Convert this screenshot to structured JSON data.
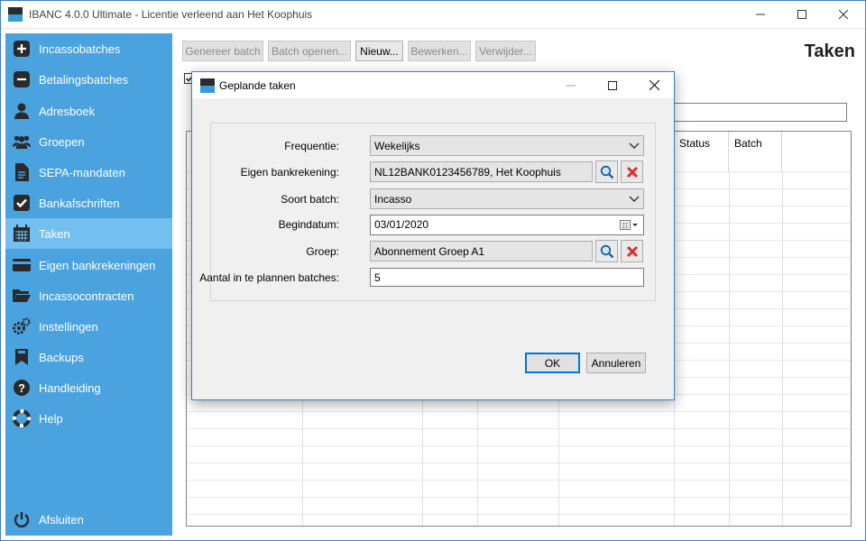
{
  "window": {
    "title": "IBANC 4.0.0 Ultimate - Licentie verleend aan Het Koophuis"
  },
  "sidebar": {
    "items": [
      {
        "label": "Incassobatches",
        "icon": "plus-circle-icon"
      },
      {
        "label": "Betalingsbatches",
        "icon": "minus-circle-icon"
      },
      {
        "label": "Adresboek",
        "icon": "person-icon"
      },
      {
        "label": "Groepen",
        "icon": "group-icon"
      },
      {
        "label": "SEPA-mandaten",
        "icon": "document-icon"
      },
      {
        "label": "Bankafschriften",
        "icon": "checkbox-icon"
      },
      {
        "label": "Taken",
        "icon": "calendar-icon"
      },
      {
        "label": "Eigen bankrekeningen",
        "icon": "card-icon"
      },
      {
        "label": "Incassocontracten",
        "icon": "folder-icon"
      },
      {
        "label": "Instellingen",
        "icon": "gear-icon"
      },
      {
        "label": "Backups",
        "icon": "bookmark-icon"
      },
      {
        "label": "Handleiding",
        "icon": "question-icon"
      },
      {
        "label": "Help",
        "icon": "lifebuoy-icon"
      }
    ],
    "active": "Taken",
    "exit_label": "Afsluiten"
  },
  "toolbar": {
    "generate": "Genereer batch",
    "open": "Batch openen...",
    "new": "Nieuw...",
    "edit": "Bewerken...",
    "delete": "Verwijder..."
  },
  "page": {
    "title": "Taken"
  },
  "grid": {
    "columns": [
      "Status",
      "Batch"
    ]
  },
  "dialog": {
    "title": "Geplande taken",
    "fields": {
      "frequency_label": "Frequentie:",
      "frequency_value": "Wekelijks",
      "account_label": "Eigen bankrekening:",
      "account_value": "NL12BANK0123456789, Het Koophuis",
      "batch_type_label": "Soort batch:",
      "batch_type_value": "Incasso",
      "start_date_label": "Begindatum:",
      "start_date_value": "03/01/2020",
      "group_label": "Groep:",
      "group_value": "Abonnement Groep A1",
      "count_label": "Aantal in te plannen batches:",
      "count_value": "5"
    },
    "ok": "OK",
    "cancel": "Annuleren"
  },
  "colors": {
    "sidebar": "#4aa3df",
    "sidebar_active": "#73bff0",
    "accent": "#0078d7"
  }
}
